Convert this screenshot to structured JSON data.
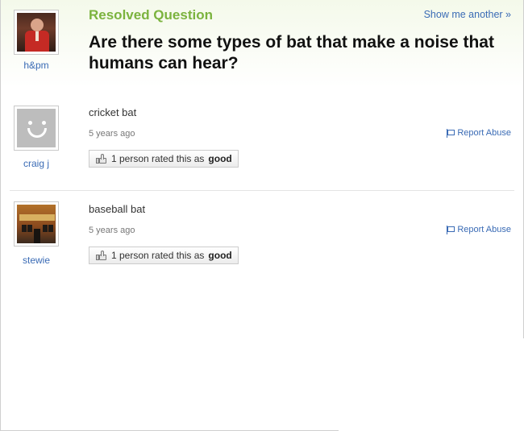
{
  "question": {
    "status": "Resolved Question",
    "show_another": "Show me another »",
    "text": "Are there some types of bat that make a noise that humans can hear?",
    "asker": {
      "name": "h&pm",
      "avatar": "person-photo-avatar"
    }
  },
  "answers": [
    {
      "user": "craig j",
      "avatar": "default-smiley-avatar",
      "text": "cricket bat",
      "time": "5 years ago",
      "report": "Report Abuse",
      "rating_prefix": "1 person rated this as",
      "rating_word": "good"
    },
    {
      "user": "stewie",
      "avatar": "building-photo-avatar",
      "text": "baseball bat",
      "time": "5 years ago",
      "report": "Report Abuse",
      "rating_prefix": "1 person rated this as",
      "rating_word": "good"
    }
  ],
  "colors": {
    "status": "#7bb33e",
    "link": "#3a6bb5",
    "question": "#111111"
  }
}
